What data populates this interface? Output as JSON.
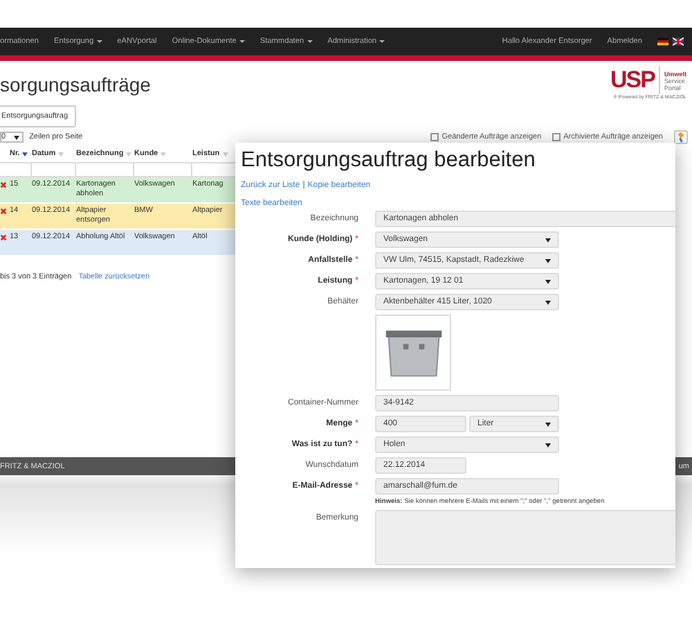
{
  "nav": {
    "items": [
      {
        "label": "ormationen",
        "dropdown": false
      },
      {
        "label": "Entsorgung",
        "dropdown": true
      },
      {
        "label": "eANVportal",
        "dropdown": false
      },
      {
        "label": "Online-Dokumente",
        "dropdown": true
      },
      {
        "label": "Stammdaten",
        "dropdown": true
      },
      {
        "label": "Administration",
        "dropdown": true
      }
    ],
    "greeting": "Hallo Alexander Entsorger",
    "logout": "Abmelden"
  },
  "logo": {
    "letters": "USP",
    "lines": [
      "Umwelt",
      "Service",
      "Portal"
    ],
    "tagline": "® Powered by FRITZ & MACZIOL"
  },
  "page": {
    "title": "sorgungsaufträge",
    "new_button": "Entsorgungsauftrag",
    "page_size": "0",
    "page_size_label": "Zeilen pro Seite",
    "filters": [
      {
        "label": "Geänderte Aufträge anzeigen",
        "checked": false
      },
      {
        "label": "Archivierte Aufträge anzeigen",
        "checked": false
      }
    ]
  },
  "table": {
    "columns": [
      {
        "label": "Nr.",
        "sorted": true
      },
      {
        "label": "Datum",
        "sorted": false
      },
      {
        "label": "Bezeichnung",
        "sorted": false
      },
      {
        "label": "Kunde",
        "sorted": false
      },
      {
        "label": "Leistun",
        "sorted": false
      }
    ],
    "rows": [
      {
        "color": "#d3efd3",
        "cells": [
          "15",
          "09.12.2014",
          "Kartonagen abholen",
          "Volkswagen",
          "Kartonag"
        ]
      },
      {
        "color": "#fcebab",
        "cells": [
          "14",
          "09.12.2014",
          "Altpapier entsorgen",
          "BMW",
          "Altpapier"
        ]
      },
      {
        "color": "#dde9f6",
        "cells": [
          "13",
          "09.12.2014",
          "Abholung Altöl",
          "Volkswagen",
          "Altöl"
        ]
      }
    ],
    "info": "bis 3 von 3 Einträgen",
    "reset_link": "Tabelle zurücksetzen"
  },
  "footer": {
    "left": "FRITZ & MACZIOL",
    "right": "um"
  },
  "dialog": {
    "title": "Entsorgungsauftrag bearbeiten",
    "required_mark": "*",
    "links": [
      "Zurück zur Liste",
      "Kopie bearbeiten"
    ],
    "separator": "|",
    "texts_link": "Texte bearbeiten",
    "fields": [
      {
        "label": "Bezeichnung",
        "required": false,
        "kind": "wide_input",
        "value": "Kartonagen abholen"
      },
      {
        "label": "Kunde (Holding)",
        "required": true,
        "kind": "select",
        "value": "Volkswagen"
      },
      {
        "label": "Anfallstelle",
        "required": true,
        "kind": "select",
        "value": "VW Ulm, 74515, Kapstadt, Radezkiwe"
      },
      {
        "label": "Leistung",
        "required": true,
        "kind": "select",
        "value": "Kartonagen, 19 12 01"
      },
      {
        "label": "Behälter",
        "required": false,
        "kind": "select",
        "value": "Aktenbehälter 415 Liter, 1020"
      },
      {
        "kind": "image"
      },
      {
        "label": "Container-Nummer",
        "required": false,
        "kind": "input",
        "value": "34-9142"
      },
      {
        "label": "Menge",
        "required": true,
        "kind": "quantity",
        "value": "400",
        "unit": "Liter"
      },
      {
        "label": "Was ist zu tun?",
        "required": true,
        "kind": "select",
        "value": "Holen"
      },
      {
        "label": "Wunschdatum",
        "required": false,
        "kind": "date_input",
        "value": "22.12.2014"
      },
      {
        "label": "E-Mail-Adresse",
        "required": true,
        "kind": "input",
        "value": "amarschall@fum.de"
      },
      {
        "kind": "hint",
        "text": "**Hinweis:** Sie können mehrere E-Mails mit einem \";\" oder \",\" getrennt angeben"
      },
      {
        "label": "Bemerkung",
        "required": false,
        "kind": "textarea"
      }
    ]
  }
}
